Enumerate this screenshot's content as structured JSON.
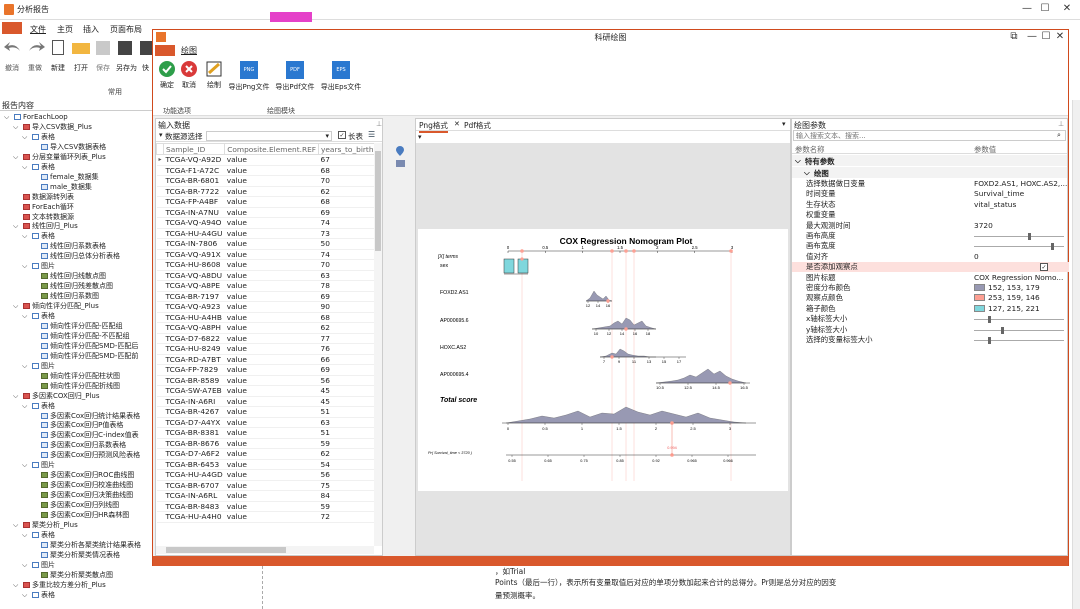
{
  "outer": {
    "title": "分析报告",
    "menu": [
      "文件",
      "主页",
      "插入",
      "页面布局"
    ],
    "ribbon_buttons": [
      "撤消",
      "重做",
      "新建",
      "打开",
      "保存",
      "另存为",
      "快"
    ],
    "ribbon_group": "常用",
    "doc_tree_title": "报告内容",
    "doc_text_line1": "，如Trial",
    "doc_text_line2": "Points（最后一行），表示所有变量取值后对应的单项分数加起来合计的总得分。Pr则是总分对应的因变",
    "doc_text_line3": "量预测概率。",
    "tree": [
      {
        "depth": 0,
        "expand": "⌵",
        "icon": "tab",
        "label": "ForEachLoop"
      },
      {
        "depth": 1,
        "expand": "⌵",
        "icon": "db",
        "label": "导入CSV数据_Plus"
      },
      {
        "depth": 2,
        "expand": "⌵",
        "icon": "tab",
        "label": "表格"
      },
      {
        "depth": 3,
        "expand": "",
        "icon": "tbl",
        "label": "导入CSV数据表格"
      },
      {
        "depth": 1,
        "expand": "⌵",
        "icon": "db",
        "label": "分层变量循环列表_Plus"
      },
      {
        "depth": 2,
        "expand": "⌵",
        "icon": "tab",
        "label": "表格"
      },
      {
        "depth": 3,
        "expand": "",
        "icon": "tbl",
        "label": "female_数据集"
      },
      {
        "depth": 3,
        "expand": "",
        "icon": "tbl",
        "label": "male_数据集"
      },
      {
        "depth": 1,
        "expand": "",
        "icon": "db",
        "label": "数据源转列表"
      },
      {
        "depth": 1,
        "expand": "",
        "icon": "db",
        "label": "ForEach循环"
      },
      {
        "depth": 1,
        "expand": "",
        "icon": "db",
        "label": "文本转数据源"
      },
      {
        "depth": 1,
        "expand": "⌵",
        "icon": "db",
        "label": "线性回归_Plus"
      },
      {
        "depth": 2,
        "expand": "⌵",
        "icon": "tab",
        "label": "表格"
      },
      {
        "depth": 3,
        "expand": "",
        "icon": "tbl",
        "label": "线性回归系数表格"
      },
      {
        "depth": 3,
        "expand": "",
        "icon": "tbl",
        "label": "线性回归总体分析表格"
      },
      {
        "depth": 2,
        "expand": "⌵",
        "icon": "tab",
        "label": "图片"
      },
      {
        "depth": 3,
        "expand": "",
        "icon": "img",
        "label": "线性回归线散点图"
      },
      {
        "depth": 3,
        "expand": "",
        "icon": "img",
        "label": "线性回归残差散点图"
      },
      {
        "depth": 3,
        "expand": "",
        "icon": "img",
        "label": "线性回归系数图"
      },
      {
        "depth": 1,
        "expand": "⌵",
        "icon": "db",
        "label": "倾向性评分匹配_Plus"
      },
      {
        "depth": 2,
        "expand": "⌵",
        "icon": "tab",
        "label": "表格"
      },
      {
        "depth": 3,
        "expand": "",
        "icon": "tbl",
        "label": "倾向性评分匹配-匹配组"
      },
      {
        "depth": 3,
        "expand": "",
        "icon": "tbl",
        "label": "倾向性评分匹配-不匹配组"
      },
      {
        "depth": 3,
        "expand": "",
        "icon": "tbl",
        "label": "倾向性评分匹配SMD-匹配后"
      },
      {
        "depth": 3,
        "expand": "",
        "icon": "tbl",
        "label": "倾向性评分匹配SMD-匹配前"
      },
      {
        "depth": 2,
        "expand": "⌵",
        "icon": "tab",
        "label": "图片"
      },
      {
        "depth": 3,
        "expand": "",
        "icon": "img",
        "label": "倾向性评分匹配柱状图"
      },
      {
        "depth": 3,
        "expand": "",
        "icon": "img",
        "label": "倾向性评分匹配折线图"
      },
      {
        "depth": 1,
        "expand": "⌵",
        "icon": "db",
        "label": "多因素COX回归_Plus"
      },
      {
        "depth": 2,
        "expand": "⌵",
        "icon": "tab",
        "label": "表格"
      },
      {
        "depth": 3,
        "expand": "",
        "icon": "tbl",
        "label": "多因素Cox回归统计结果表格"
      },
      {
        "depth": 3,
        "expand": "",
        "icon": "tbl",
        "label": "多因素Cox回归P值表格"
      },
      {
        "depth": 3,
        "expand": "",
        "icon": "tbl",
        "label": "多因素Cox回归C-index值表"
      },
      {
        "depth": 3,
        "expand": "",
        "icon": "tbl",
        "label": "多因素Cox回归系数表格"
      },
      {
        "depth": 3,
        "expand": "",
        "icon": "tbl",
        "label": "多因素Cox回归预测风险表格"
      },
      {
        "depth": 2,
        "expand": "⌵",
        "icon": "tab",
        "label": "图片"
      },
      {
        "depth": 3,
        "expand": "",
        "icon": "img",
        "label": "多因素Cox回归ROC曲线图"
      },
      {
        "depth": 3,
        "expand": "",
        "icon": "img",
        "label": "多因素Cox回归校准曲线图"
      },
      {
        "depth": 3,
        "expand": "",
        "icon": "img",
        "label": "多因素Cox回归决策曲线图"
      },
      {
        "depth": 3,
        "expand": "",
        "icon": "img",
        "label": "多因素Cox回归列线图"
      },
      {
        "depth": 3,
        "expand": "",
        "icon": "img",
        "label": "多因素Cox回归HR森林图"
      },
      {
        "depth": 1,
        "expand": "⌵",
        "icon": "db",
        "label": "聚类分析_Plus"
      },
      {
        "depth": 2,
        "expand": "⌵",
        "icon": "tab",
        "label": "表格"
      },
      {
        "depth": 3,
        "expand": "",
        "icon": "tbl",
        "label": "聚类分析各聚类统计结果表格"
      },
      {
        "depth": 3,
        "expand": "",
        "icon": "tbl",
        "label": "聚类分析聚类情况表格"
      },
      {
        "depth": 2,
        "expand": "⌵",
        "icon": "tab",
        "label": "图片"
      },
      {
        "depth": 3,
        "expand": "",
        "icon": "img",
        "label": "聚类分析聚类散点图"
      },
      {
        "depth": 1,
        "expand": "⌵",
        "icon": "db",
        "label": "多重比较方差分析_Plus"
      },
      {
        "depth": 2,
        "expand": "⌵",
        "icon": "tab",
        "label": "表格"
      }
    ]
  },
  "modal": {
    "title": "科研绘图",
    "menu": "绘图",
    "buttons": [
      "确定",
      "取消",
      "绘制",
      "导出Png文件",
      "导出Pdf文件",
      "导出Eps文件"
    ],
    "groups": [
      "功能选项",
      "绘图模块"
    ],
    "input": {
      "title": "输入数据",
      "source_label": "数据源选择",
      "long_table_label": "长表",
      "columns": [
        "Sample_ID",
        "Composite.Element.REF",
        "years_to_birth"
      ],
      "rows": [
        [
          "TCGA-VQ-A92D",
          "value",
          "67"
        ],
        [
          "TCGA-F1-A72C",
          "value",
          "68"
        ],
        [
          "TCGA-BR-6801",
          "value",
          "70"
        ],
        [
          "TCGA-BR-7722",
          "value",
          "62"
        ],
        [
          "TCGA-FP-A4BF",
          "value",
          "68"
        ],
        [
          "TCGA-IN-A7NU",
          "value",
          "69"
        ],
        [
          "TCGA-VQ-A94O",
          "value",
          "74"
        ],
        [
          "TCGA-HU-A4GU",
          "value",
          "73"
        ],
        [
          "TCGA-IN-7806",
          "value",
          "50"
        ],
        [
          "TCGA-VQ-A91X",
          "value",
          "74"
        ],
        [
          "TCGA-HU-8608",
          "value",
          "70"
        ],
        [
          "TCGA-VQ-A8DU",
          "value",
          "63"
        ],
        [
          "TCGA-VQ-A8PE",
          "value",
          "78"
        ],
        [
          "TCGA-BR-7197",
          "value",
          "69"
        ],
        [
          "TCGA-VQ-A923",
          "value",
          "90"
        ],
        [
          "TCGA-HU-A4HB",
          "value",
          "68"
        ],
        [
          "TCGA-VQ-A8PH",
          "value",
          "62"
        ],
        [
          "TCGA-D7-6822",
          "value",
          "77"
        ],
        [
          "TCGA-HU-8249",
          "value",
          "76"
        ],
        [
          "TCGA-RD-A7BT",
          "value",
          "66"
        ],
        [
          "TCGA-FP-7829",
          "value",
          "69"
        ],
        [
          "TCGA-BR-8589",
          "value",
          "56"
        ],
        [
          "TCGA-SW-A7EB",
          "value",
          "45"
        ],
        [
          "TCGA-IN-A6RI",
          "value",
          "45"
        ],
        [
          "TCGA-BR-4267",
          "value",
          "51"
        ],
        [
          "TCGA-D7-A4YX",
          "value",
          "63"
        ],
        [
          "TCGA-BR-8381",
          "value",
          "51"
        ],
        [
          "TCGA-BR-8676",
          "value",
          "59"
        ],
        [
          "TCGA-D7-A6F2",
          "value",
          "62"
        ],
        [
          "TCGA-BR-6453",
          "value",
          "54"
        ],
        [
          "TCGA-HU-A4GD",
          "value",
          "56"
        ],
        [
          "TCGA-BR-6707",
          "value",
          "75"
        ],
        [
          "TCGA-IN-A6RL",
          "value",
          "84"
        ],
        [
          "TCGA-BR-8483",
          "value",
          "59"
        ],
        [
          "TCGA-HU-A4H0",
          "value",
          "72"
        ]
      ]
    },
    "tabs": [
      "Png格式",
      "Pdf格式"
    ],
    "plot": {
      "title": "COX Regression Nomogram Plot",
      "points_label": "[X] terms",
      "vars": [
        "sex",
        "FOXD2.AS1",
        "AP000695.6",
        "HOXC.AS2",
        "AP000695.4",
        "Total score"
      ],
      "axis_label": "Pr( Survival_time < 3720 )",
      "top_ticks": [
        "0",
        "0.5",
        "1",
        "1.5",
        "2",
        "2.5",
        "3"
      ],
      "foxd2_ticks": [
        "12",
        "14",
        "16"
      ],
      "ap6_ticks": [
        "10",
        "12",
        "14",
        "16",
        "18"
      ],
      "hoxc_ticks": [
        "7",
        "9",
        "11",
        "13",
        "15",
        "17"
      ],
      "ap4_ticks": [
        "10.5",
        "12.5",
        "14.5",
        "16.5"
      ],
      "total_ticks": [
        "0",
        "0.5",
        "1",
        "1.5",
        "2",
        "2.5",
        "3"
      ],
      "pr_ticks": [
        "0.55",
        "0.65",
        "0.75",
        "0.85",
        "0.92",
        "0.965",
        "0.966"
      ],
      "highlight_label": "0.994"
    },
    "params": {
      "title": "绘图参数",
      "search_placeholder": "输入搜索文本、搜索...",
      "col_name": "参数名称",
      "col_value": "参数值",
      "cat_special": "特有参数",
      "cat_plot": "绘图",
      "rows": [
        {
          "k": "选择数据做日变量",
          "v": "FOXD2.AS1, HOXC.AS2,..."
        },
        {
          "k": "时间变量",
          "v": "Survival_time"
        },
        {
          "k": "生存状态",
          "v": "vital_status"
        },
        {
          "k": "权重变量",
          "v": ""
        },
        {
          "k": "最大观测时间",
          "v": "3720"
        },
        {
          "k": "画布高度",
          "v": "",
          "slider": 0.6
        },
        {
          "k": "画布宽度",
          "v": "",
          "slider": 0.85
        },
        {
          "k": "值对齐",
          "v": "0"
        },
        {
          "k": "是否添加观察点",
          "v": "",
          "check": true,
          "hl": true
        },
        {
          "k": "图片标题",
          "v": "COX Regression Nomo..."
        },
        {
          "k": "密度分布颜色",
          "v": "152, 153, 179",
          "color": "#9899b3"
        },
        {
          "k": "观察点颜色",
          "v": "253, 159, 146",
          "color": "#fd9f92"
        },
        {
          "k": "箱子颜色",
          "v": "127, 215, 221",
          "color": "#7fd7dd"
        },
        {
          "k": "x轴标签大小",
          "v": "",
          "slider": 0.15
        },
        {
          "k": "y轴标签大小",
          "v": "",
          "slider": 0.3
        },
        {
          "k": "选择的变量标签大小",
          "v": "",
          "slider": 0.15
        }
      ]
    }
  }
}
